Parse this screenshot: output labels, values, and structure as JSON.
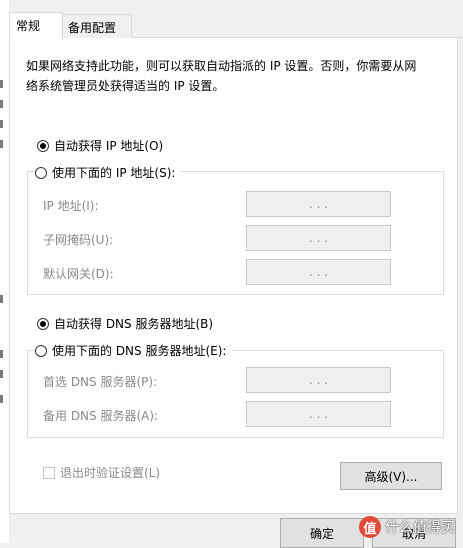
{
  "tabs": [
    {
      "label": "常规"
    },
    {
      "label": "备用配置"
    }
  ],
  "intro_text_line1": "如果网络支持此功能，则可以获取自动指派的 IP 设置。否则，你需要从网",
  "intro_text_line2": "络系统管理员处获得适当的 IP 设置。",
  "ip": {
    "auto_label": "自动获得 IP 地址(O)",
    "manual_label": "使用下面的 IP 地址(S):",
    "selected": "auto",
    "fields": [
      {
        "label": "IP 地址(I):",
        "value": ".     .     ."
      },
      {
        "label": "子网掩码(U):",
        "value": ".     .     ."
      },
      {
        "label": "默认网关(D):",
        "value": ".     .     ."
      }
    ]
  },
  "dns": {
    "auto_label": "自动获得 DNS 服务器地址(B)",
    "manual_label": "使用下面的 DNS 服务器地址(E):",
    "selected": "auto",
    "fields": [
      {
        "label": "首选 DNS 服务器(P):",
        "value": ".     .     ."
      },
      {
        "label": "备用 DNS 服务器(A):",
        "value": ".     .     ."
      }
    ]
  },
  "validate_checkbox_label": "退出时验证设置(L)",
  "validate_checked": false,
  "advanced_button": "高级(V)...",
  "ok_button": "确定",
  "cancel_button": "取消",
  "watermark": {
    "logo_char": "值",
    "text": "什么值得买"
  }
}
